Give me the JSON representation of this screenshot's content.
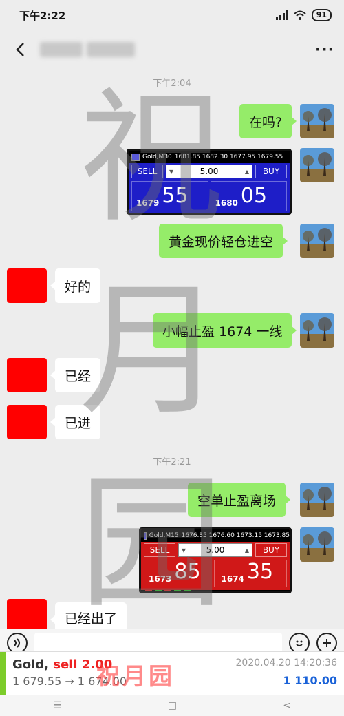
{
  "status": {
    "time": "下午2:22",
    "battery": "91"
  },
  "nav": {
    "more": "···"
  },
  "messages": {
    "ts1": "下午2:04",
    "m1": "在吗?",
    "m2": "黄金现价轻仓进空",
    "r1": "好的",
    "m3": "小幅止盈 1674 一线",
    "r2": "已经",
    "r3": "已进",
    "ts2": "下午2:21",
    "m4": "空单止盈离场",
    "r4": "已经出了"
  },
  "trade1": {
    "title": "Gold,M30",
    "quotes": "1681.85  1682.30  1677.95  1679.55",
    "sell": "SELL",
    "buy": "BUY",
    "lot": "5.00",
    "bid_prefix": "1679",
    "bid_big": "55",
    "ask_prefix": "1680",
    "ask_big": "05"
  },
  "trade2": {
    "title": "Gold,M15",
    "quotes": "1676.35  1676.60  1673.15  1673.85",
    "sell": "SELL",
    "buy": "BUY",
    "lot": "5.00",
    "bid_prefix": "1673",
    "bid_big": "85",
    "ask_prefix": "1674",
    "ask_big": "35"
  },
  "watermark": {
    "c1": "祝",
    "c2": "月",
    "c3": "园"
  },
  "notification": {
    "instrument": "Gold, ",
    "action": "sell 2.00",
    "prices": "1 679.55 → 1 674.00",
    "date": "2020.04.20 14:20:36",
    "profit": "1 110.00",
    "stamp": "祝月园"
  },
  "sysnav": {
    "menu": "☰",
    "home": "□",
    "back": "<"
  }
}
